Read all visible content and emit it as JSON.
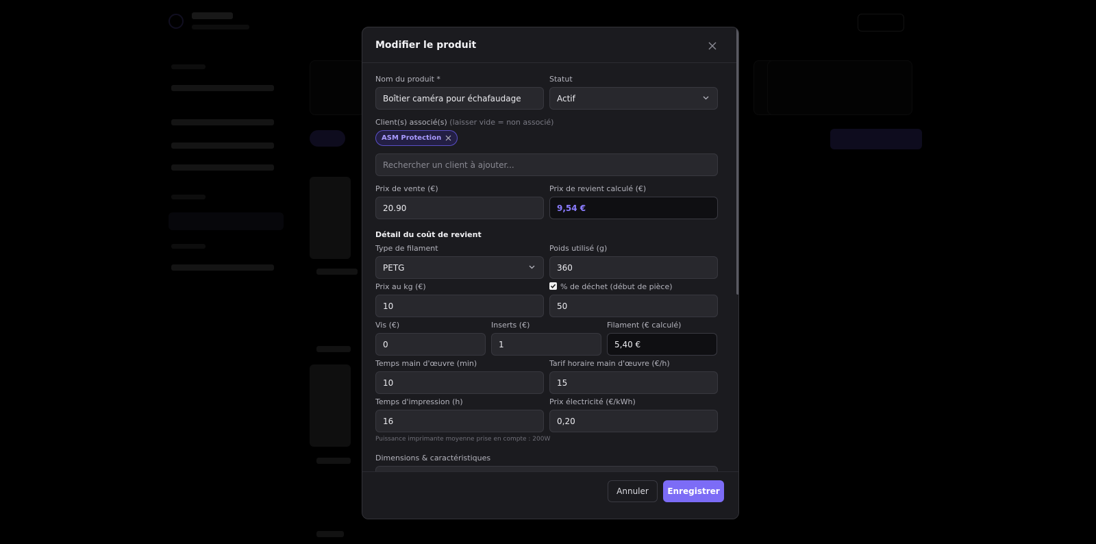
{
  "modal": {
    "title": "Modifier le produit",
    "close_icon": "close-icon"
  },
  "form": {
    "product_name_label": "Nom du produit *",
    "product_name_value": "Boîtier caméra pour échafaudage",
    "status_label": "Statut",
    "status_value": "Actif",
    "clients_label": "Client(s) associé(s)",
    "clients_hint": "(laisser vide = non associé)",
    "client_chip": "ASM Protection",
    "client_search_placeholder": "Rechercher un client à ajouter...",
    "sale_price_label": "Prix de vente (€)",
    "sale_price_value": "20.90",
    "cost_price_label": "Prix de revient calculé (€)",
    "cost_price_value": "9,54 €",
    "cost_detail_heading": "Détail du coût de revient",
    "filament_type_label": "Type de filament",
    "filament_type_value": "PETG",
    "weight_label": "Poids utilisé (g)",
    "weight_value": "360",
    "price_per_kg_label": "Prix au kg (€)",
    "price_per_kg_value": "10",
    "waste_label": "% de déchet (début de pièce)",
    "waste_checked": true,
    "waste_value": "50",
    "screws_label": "Vis (€)",
    "screws_value": "0",
    "inserts_label": "Inserts (€)",
    "inserts_value": "1",
    "filament_cost_label": "Filament (€ calculé)",
    "filament_cost_value": "5,40 €",
    "labor_time_label": "Temps main d'œuvre (min)",
    "labor_time_value": "10",
    "labor_rate_label": "Tarif horaire main d'œuvre (€/h)",
    "labor_rate_value": "15",
    "print_time_label": "Temps d'impression (h)",
    "print_time_value": "16",
    "electricity_label": "Prix électricité (€/kWh)",
    "electricity_value": "0,20",
    "power_note": "Puissance imprimante moyenne prise en compte : 200W",
    "dimensions_label": "Dimensions & caractéristiques"
  },
  "footer": {
    "cancel_label": "Annuler",
    "save_label": "Enregistrer"
  },
  "colors": {
    "accent": "#7c6cf6",
    "modal_bg": "#1b1b1f",
    "field_bg": "#28282d"
  }
}
